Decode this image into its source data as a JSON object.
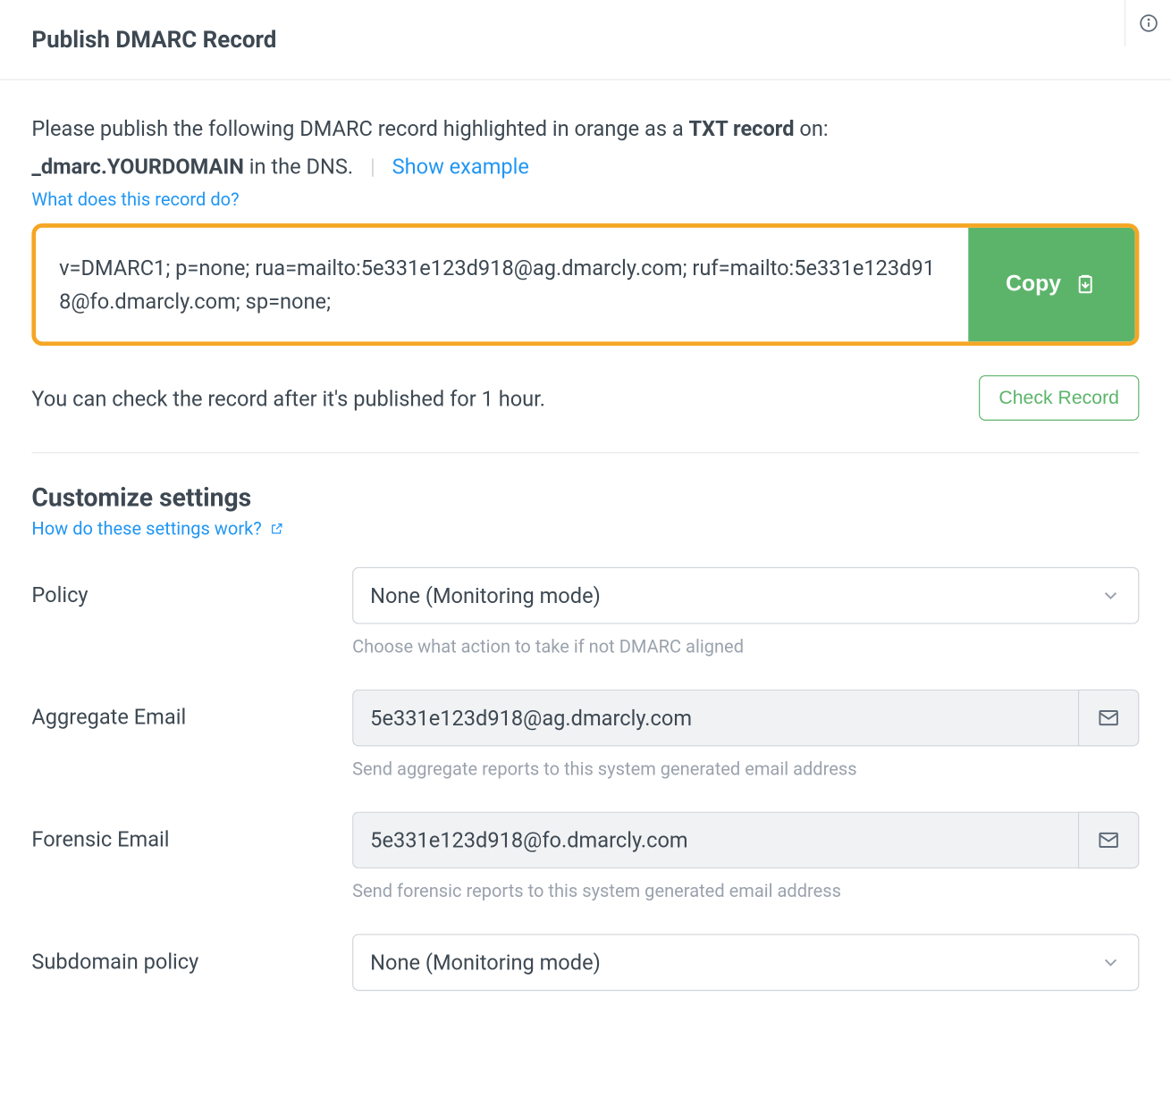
{
  "header": {
    "title": "Publish DMARC Record"
  },
  "intro": {
    "line1_pre": "Please publish the following DMARC record highlighted in orange as a ",
    "line1_bold": "TXT record",
    "line1_post": " on:",
    "line2_bold": "_dmarc.YOURDOMAIN",
    "line2_post": " in the DNS.",
    "show_example": "Show example",
    "what_link": "What does this record do?"
  },
  "record": {
    "value": "v=DMARC1; p=none; rua=mailto:5e331e123d918@ag.dmarcly.com; ruf=mailto:5e331e123d918@fo.dmarcly.com; sp=none;",
    "copy_label": "Copy"
  },
  "check": {
    "text": "You can check the record after it's published for 1 hour.",
    "button": "Check Record"
  },
  "customize": {
    "heading": "Customize settings",
    "how_link": "How do these settings work?"
  },
  "fields": {
    "policy": {
      "label": "Policy",
      "value": "None (Monitoring mode)",
      "help": "Choose what action to take if not DMARC aligned"
    },
    "aggregate": {
      "label": "Aggregate Email",
      "value": "5e331e123d918@ag.dmarcly.com",
      "help": "Send aggregate reports to this system generated email address"
    },
    "forensic": {
      "label": "Forensic Email",
      "value": "5e331e123d918@fo.dmarcly.com",
      "help": "Send forensic reports to this system generated email address"
    },
    "subdomain": {
      "label": "Subdomain policy",
      "value": "None (Monitoring mode)"
    }
  }
}
